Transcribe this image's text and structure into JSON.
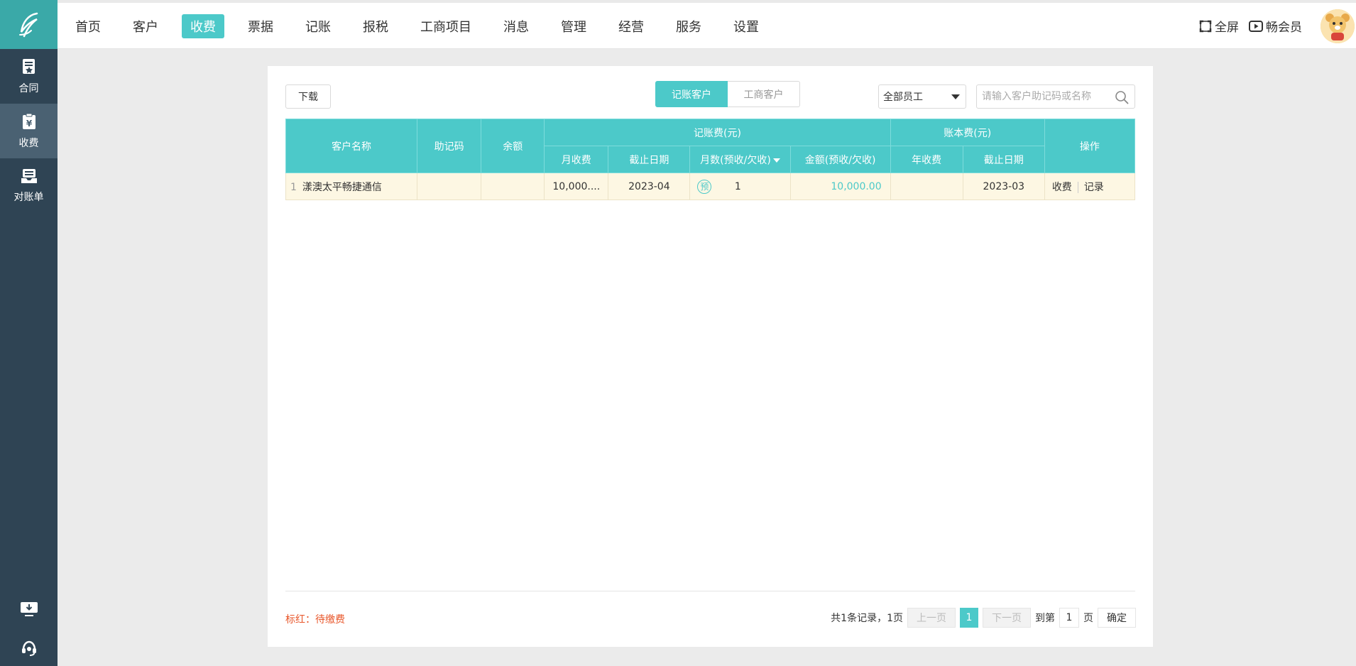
{
  "nav": {
    "items": [
      "首页",
      "客户",
      "收费",
      "票据",
      "记账",
      "报税",
      "工商项目",
      "消息",
      "管理",
      "经营",
      "服务",
      "设置"
    ],
    "active_index": 2
  },
  "top_right": {
    "fullscreen_label": "全屏",
    "member_label": "畅会员"
  },
  "sidebar": {
    "items": [
      {
        "label": "合同",
        "icon": "contract-icon"
      },
      {
        "label": "收费",
        "icon": "yuan-clipboard-icon"
      },
      {
        "label": "对账单",
        "icon": "statement-icon"
      }
    ]
  },
  "toolbar": {
    "download_label": "下载",
    "tabs": [
      "记账客户",
      "工商客户"
    ],
    "employee_select": "全部员工",
    "search_placeholder": "请输入客户助记码或名称"
  },
  "table": {
    "headers": {
      "customer_name": "客户名称",
      "memo_code": "助记码",
      "balance": "余额",
      "bookkeeping_group": "记账费(元)",
      "monthly_fee": "月收费",
      "due_date": "截止日期",
      "months": "月数(预收/欠收)",
      "amount": "金额(预收/欠收)",
      "ledger_group": "账本费(元)",
      "annual_fee": "年收费",
      "ledger_due_date": "截止日期",
      "actions": "操作"
    },
    "rows": [
      {
        "index": "1",
        "customer_name": "漾澳太平畅捷通信",
        "memo_code": "",
        "balance": "",
        "monthly_fee": "10,000....",
        "due_date": "2023-04",
        "prepaid_badge": "预",
        "months": "1",
        "amount": "10,000.00",
        "annual_fee": "",
        "ledger_due_date": "2023-03",
        "action_charge": "收费",
        "action_record": "记录"
      }
    ]
  },
  "footer": {
    "legend": "标红：待缴费",
    "summary": "共1条记录，1页",
    "prev_label": "上一页",
    "current_page": "1",
    "next_label": "下一页",
    "goto_label": "到第",
    "goto_value": "1",
    "page_suffix": "页",
    "confirm_label": "确定"
  },
  "colors": {
    "accent": "#4cc9c9",
    "sidebar": "#2f4454",
    "warning": "#e8562a"
  }
}
